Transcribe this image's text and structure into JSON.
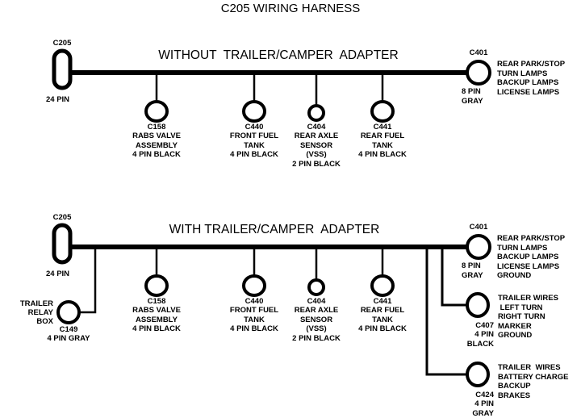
{
  "page": {
    "title": "C205 WIRING HARNESS",
    "background": "#ffffff",
    "ink": "#000000"
  },
  "diagrams": [
    {
      "id": "without-adapter",
      "title": "WITHOUT  TRAILER/CAMPER  ADAPTER",
      "source": {
        "code": "C205",
        "pins": "24 PIN"
      },
      "branches": [
        {
          "code": "C158",
          "desc": "RABS VALVE\nASSEMBLY\n4 PIN BLACK"
        },
        {
          "code": "C440",
          "desc": "FRONT FUEL\nTANK\n4 PIN BLACK"
        },
        {
          "code": "C404",
          "desc": "REAR AXLE\nSENSOR\n(VSS)\n2 PIN BLACK"
        },
        {
          "code": "C441",
          "desc": "REAR FUEL\nTANK\n4 PIN BLACK"
        }
      ],
      "terminals": [
        {
          "code": "C401",
          "pins": "8 PIN\nGRAY",
          "functions": "REAR PARK/STOP\nTURN LAMPS\nBACKUP LAMPS\nLICENSE LAMPS"
        }
      ]
    },
    {
      "id": "with-adapter",
      "title": "WITH TRAILER/CAMPER  ADAPTER",
      "source": {
        "code": "C205",
        "pins": "24 PIN"
      },
      "relay": {
        "label": "TRAILER\nRELAY\nBOX",
        "code": "C149",
        "pins": "4 PIN GRAY"
      },
      "branches": [
        {
          "code": "C158",
          "desc": "RABS VALVE\nASSEMBLY\n4 PIN BLACK"
        },
        {
          "code": "C440",
          "desc": "FRONT FUEL\nTANK\n4 PIN BLACK"
        },
        {
          "code": "C404",
          "desc": "REAR AXLE\nSENSOR\n(VSS)\n2 PIN BLACK"
        },
        {
          "code": "C441",
          "desc": "REAR FUEL\nTANK\n4 PIN BLACK"
        }
      ],
      "terminals": [
        {
          "code": "C401",
          "pins": "8 PIN\nGRAY",
          "functions": "REAR PARK/STOP\nTURN LAMPS\nBACKUP LAMPS\nLICENSE LAMPS\nGROUND"
        },
        {
          "code": "C407",
          "pins": "4 PIN\nBLACK",
          "functions": "TRAILER WIRES\n LEFT TURN\nRIGHT TURN\nMARKER\nGROUND"
        },
        {
          "code": "C424",
          "pins": "4 PIN\nGRAY",
          "functions": "TRAILER  WIRES\nBATTERY CHARGE\nBACKUP\nBRAKES"
        }
      ]
    }
  ]
}
